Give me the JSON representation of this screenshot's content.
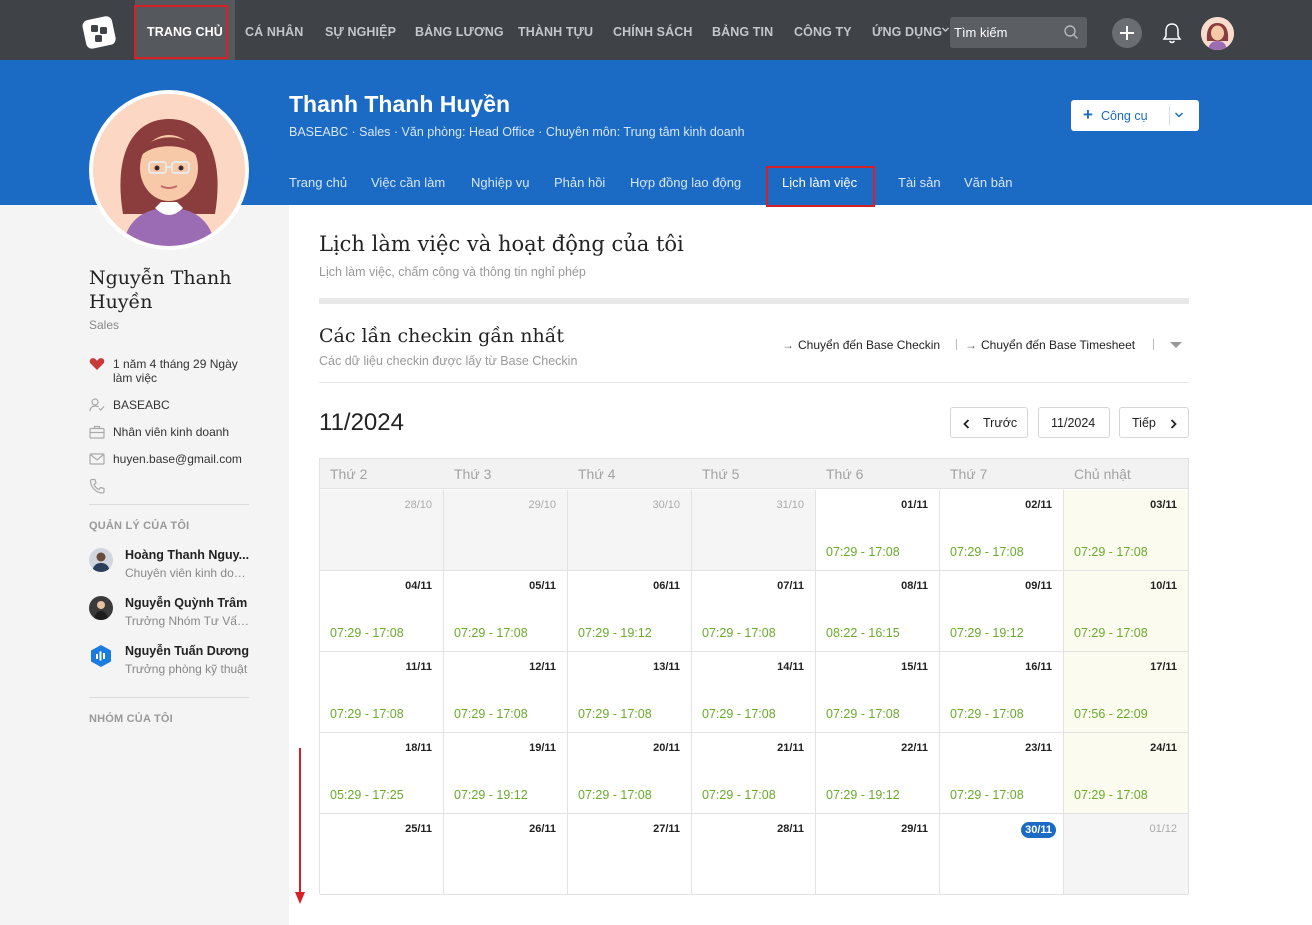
{
  "topnav": {
    "items": [
      "TRANG CHỦ",
      "CÁ NHÂN",
      "SỰ NGHIỆP",
      "BẢNG LƯƠNG",
      "THÀNH TỰU",
      "CHÍNH SÁCH",
      "BẢNG TIN",
      "CÔNG TY",
      "ỨNG DỤNG"
    ],
    "search_placeholder": "Tìm kiếm"
  },
  "header": {
    "name": "Thanh Thanh Huyền",
    "meta": "BASEABC · Sales · Văn phòng: Head Office · Chuyên môn: Trung tâm kinh doanh",
    "tool_button": "Công cụ",
    "tabs": [
      "Trang chủ",
      "Việc cần làm",
      "Nghiệp vụ",
      "Phản hồi",
      "Hợp đồng lao động",
      "Lịch làm việc",
      "Tài sản",
      "Văn bản"
    ]
  },
  "sidebar": {
    "name": "Nguyễn Thanh Huyền",
    "role": "Sales",
    "tenure_line1": "1 năm 4 tháng 29 Ngày",
    "tenure_line2": "làm việc",
    "company": "BASEABC",
    "position": "Nhân viên kinh doanh",
    "email": "huyen.base@gmail.com",
    "managers_title": "QUẢN LÝ CỦA TÔI",
    "managers": [
      {
        "name": "Hoàng Thanh Nguy...",
        "title": "Chuyên viên kinh doa..."
      },
      {
        "name": "Nguyễn Quỳnh Trâm",
        "title": "Trưởng Nhóm Tư Vấn..."
      },
      {
        "name": "Nguyễn Tuấn Dương",
        "title": "Trưởng phòng kỹ thuật"
      }
    ],
    "groups_title": "NHÓM CỦA TÔI"
  },
  "main": {
    "title": "Lịch làm việc và hoạt động của tôi",
    "subtitle": "Lịch làm việc, chấm công và thông tin nghỉ phép",
    "checkin_title": "Các lần checkin gần nhất",
    "checkin_subtitle": "Các dữ liệu checkin được lấy từ Base Checkin",
    "link_checkin": "Chuyển đến Base Checkin",
    "link_timesheet": "Chuyển đến Base Timesheet",
    "month": "11/2024",
    "prev_label": "Trước",
    "current_label": "11/2024",
    "next_label": "Tiếp"
  },
  "calendar": {
    "weekdays": [
      "Thứ 2",
      "Thứ 3",
      "Thứ 4",
      "Thứ 5",
      "Thứ 6",
      "Thứ 7",
      "Chủ nhật"
    ],
    "rows": [
      [
        {
          "d": "28/10",
          "t": "",
          "out": true
        },
        {
          "d": "29/10",
          "t": "",
          "out": true
        },
        {
          "d": "30/10",
          "t": "",
          "out": true
        },
        {
          "d": "31/10",
          "t": "",
          "out": true
        },
        {
          "d": "01/11",
          "t": "07:29 - 17:08"
        },
        {
          "d": "02/11",
          "t": "07:29 - 17:08"
        },
        {
          "d": "03/11",
          "t": "07:29 - 17:08"
        }
      ],
      [
        {
          "d": "04/11",
          "t": "07:29 - 17:08"
        },
        {
          "d": "05/11",
          "t": "07:29 - 17:08"
        },
        {
          "d": "06/11",
          "t": "07:29 - 19:12"
        },
        {
          "d": "07/11",
          "t": "07:29 - 17:08"
        },
        {
          "d": "08/11",
          "t": "08:22 - 16:15"
        },
        {
          "d": "09/11",
          "t": "07:29 - 19:12"
        },
        {
          "d": "10/11",
          "t": "07:29 - 17:08"
        }
      ],
      [
        {
          "d": "11/11",
          "t": "07:29 - 17:08"
        },
        {
          "d": "12/11",
          "t": "07:29 - 17:08"
        },
        {
          "d": "13/11",
          "t": "07:29 - 17:08"
        },
        {
          "d": "14/11",
          "t": "07:29 - 17:08"
        },
        {
          "d": "15/11",
          "t": "07:29 - 17:08"
        },
        {
          "d": "16/11",
          "t": "07:29 - 17:08"
        },
        {
          "d": "17/11",
          "t": "07:56 - 22:09"
        }
      ],
      [
        {
          "d": "18/11",
          "t": "05:29 - 17:25"
        },
        {
          "d": "19/11",
          "t": "07:29 - 19:12"
        },
        {
          "d": "20/11",
          "t": "07:29 - 17:08"
        },
        {
          "d": "21/11",
          "t": "07:29 - 17:08"
        },
        {
          "d": "22/11",
          "t": "07:29 - 19:12"
        },
        {
          "d": "23/11",
          "t": "07:29 - 17:08"
        },
        {
          "d": "24/11",
          "t": "07:29 - 17:08"
        }
      ],
      [
        {
          "d": "25/11",
          "t": ""
        },
        {
          "d": "26/11",
          "t": ""
        },
        {
          "d": "27/11",
          "t": ""
        },
        {
          "d": "28/11",
          "t": ""
        },
        {
          "d": "29/11",
          "t": ""
        },
        {
          "d": "30/11",
          "t": "",
          "today": true
        },
        {
          "d": "01/12",
          "t": "",
          "out": true
        }
      ]
    ]
  },
  "colors": {
    "header_blue": "#1b6ac4",
    "topnav": "#3f4246",
    "time_green": "#6aaa2a",
    "highlight_red": "#d61f26"
  }
}
